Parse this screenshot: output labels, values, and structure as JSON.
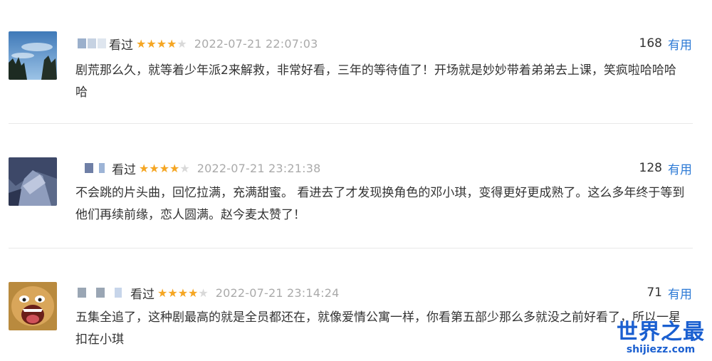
{
  "reviews": [
    {
      "watched_label": "看过",
      "rating": 4,
      "max_rating": 5,
      "time": "2022-07-21 22:07:03",
      "votes": "168",
      "useful_label": "有用",
      "text": "剧荒那么久，就等着少年派2来解救，非常好看，三年的等待值了！开场就是妙妙带着弟弟去上课，笑疯啦哈哈哈哈"
    },
    {
      "watched_label": "看过",
      "rating": 4,
      "max_rating": 5,
      "time": "2022-07-21 23:21:38",
      "votes": "128",
      "useful_label": "有用",
      "text": "不会跳的片头曲，回忆拉满，充满甜蜜。 看进去了才发现换角色的邓小琪，变得更好更成熟了。这么多年终于等到他们再续前缘，恋人圆满。赵今麦太赞了！"
    },
    {
      "watched_label": "看过",
      "rating": 4,
      "max_rating": 5,
      "time": "2022-07-21 23:14:24",
      "votes": "71",
      "useful_label": "有用",
      "text": "五集全追了，这种剧最高的就是全员都还在，就像爱情公寓一样，你看第五部少那么多就没之前好看了，所以一星扣在小琪"
    }
  ],
  "watermark": {
    "title": "世界之最",
    "url": "shijiezz.com"
  },
  "colors": {
    "star": "#f5a623",
    "link": "#2e7bd6",
    "time": "#aaaaaa"
  }
}
